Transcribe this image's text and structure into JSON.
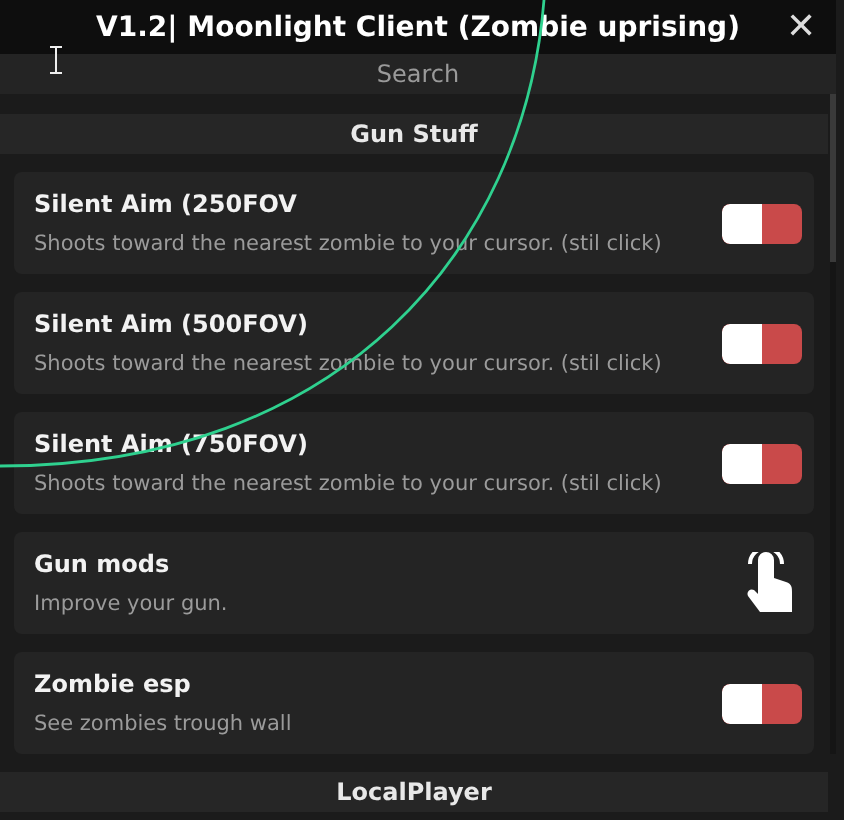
{
  "window": {
    "title": "V1.2| Moonlight Client (Zombie uprising)",
    "close": "✕"
  },
  "search": {
    "placeholder": "Search"
  },
  "sections": [
    {
      "title": "Gun Stuff",
      "items": [
        {
          "kind": "toggle",
          "name": "Silent Aim (250FOV",
          "description": "Shoots toward the nearest zombie to your cursor. (stil click)",
          "on": false
        },
        {
          "kind": "toggle",
          "name": "Silent Aim (500FOV)",
          "description": "Shoots toward the nearest zombie to your cursor. (stil click)",
          "on": false
        },
        {
          "kind": "toggle",
          "name": "Silent Aim (750FOV)",
          "description": "Shoots toward the nearest zombie to your cursor. (stil click)",
          "on": false
        },
        {
          "kind": "button",
          "name": "Gun mods",
          "description": "Improve your gun."
        },
        {
          "kind": "toggle",
          "name": "Zombie esp",
          "description": "See zombies trough wall",
          "on": false
        }
      ]
    },
    {
      "title": "LocalPlayer"
    }
  ]
}
